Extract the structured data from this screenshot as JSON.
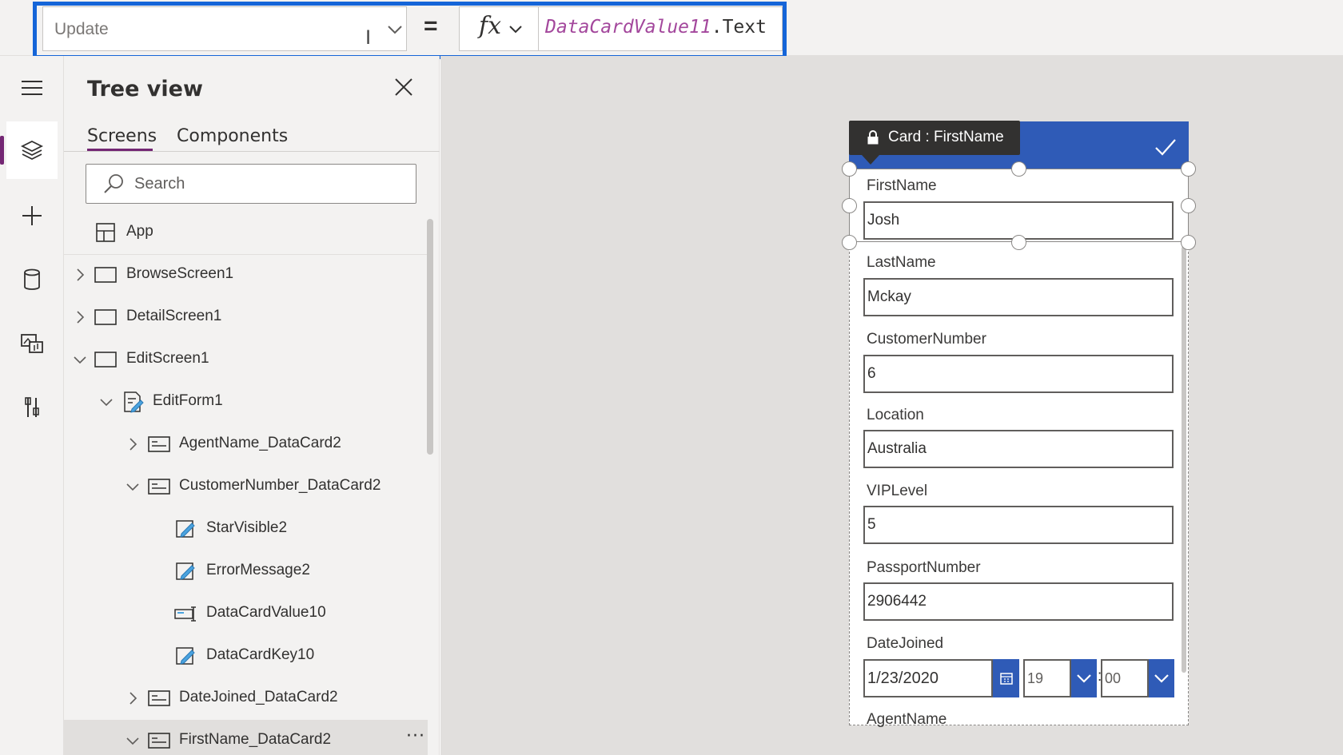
{
  "formula_bar": {
    "property": "Update",
    "fx_label": "fx",
    "formula_identifier": "DataCardValue11",
    "formula_member": ".Text"
  },
  "left_rail": {
    "items": [
      {
        "icon": "hamburger-icon"
      },
      {
        "icon": "layers-icon",
        "active": true
      },
      {
        "icon": "plus-icon"
      },
      {
        "icon": "database-icon"
      },
      {
        "icon": "media-icon"
      },
      {
        "icon": "tools-icon"
      }
    ]
  },
  "tree_view": {
    "title": "Tree view",
    "tabs": [
      "Screens",
      "Components"
    ],
    "search_placeholder": "Search",
    "items": [
      {
        "label": "App",
        "icon": "app-icon"
      },
      {
        "label": "BrowseScreen1",
        "icon": "screen-icon",
        "expanded": false
      },
      {
        "label": "DetailScreen1",
        "icon": "screen-icon",
        "expanded": false
      },
      {
        "label": "EditScreen1",
        "icon": "screen-icon",
        "expanded": true
      },
      {
        "label": "EditForm1",
        "icon": "form-icon",
        "expanded": true
      },
      {
        "label": "AgentName_DataCard2",
        "icon": "card-icon",
        "expanded": false
      },
      {
        "label": "CustomerNumber_DataCard2",
        "icon": "card-icon",
        "expanded": true
      },
      {
        "label": "StarVisible2",
        "icon": "label-edit-icon"
      },
      {
        "label": "ErrorMessage2",
        "icon": "label-edit-icon"
      },
      {
        "label": "DataCardValue10",
        "icon": "text-input-icon"
      },
      {
        "label": "DataCardKey10",
        "icon": "label-edit-icon"
      },
      {
        "label": "DateJoined_DataCard2",
        "icon": "card-icon",
        "expanded": false
      },
      {
        "label": "FirstName_DataCard2",
        "icon": "card-icon",
        "expanded": true,
        "selected": true
      }
    ],
    "more_label": "···"
  },
  "form": {
    "tooltip": "Card : FirstName",
    "fields": [
      {
        "label": "FirstName",
        "value": "Josh"
      },
      {
        "label": "LastName",
        "value": "Mckay"
      },
      {
        "label": "CustomerNumber",
        "value": "6"
      },
      {
        "label": "Location",
        "value": "Australia"
      },
      {
        "label": "VIPLevel",
        "value": "5"
      },
      {
        "label": "PassportNumber",
        "value": "2906442"
      }
    ],
    "date_joined": {
      "label": "DateJoined",
      "date": "1/23/2020",
      "hour": "19",
      "separator": ":",
      "minute": "00"
    },
    "last_label": "AgentName"
  },
  "colors": {
    "accent": "#2f5bb7",
    "highlight": "#1565d8",
    "rail_active": "#742774",
    "formula_identifier": "#a3479c"
  }
}
